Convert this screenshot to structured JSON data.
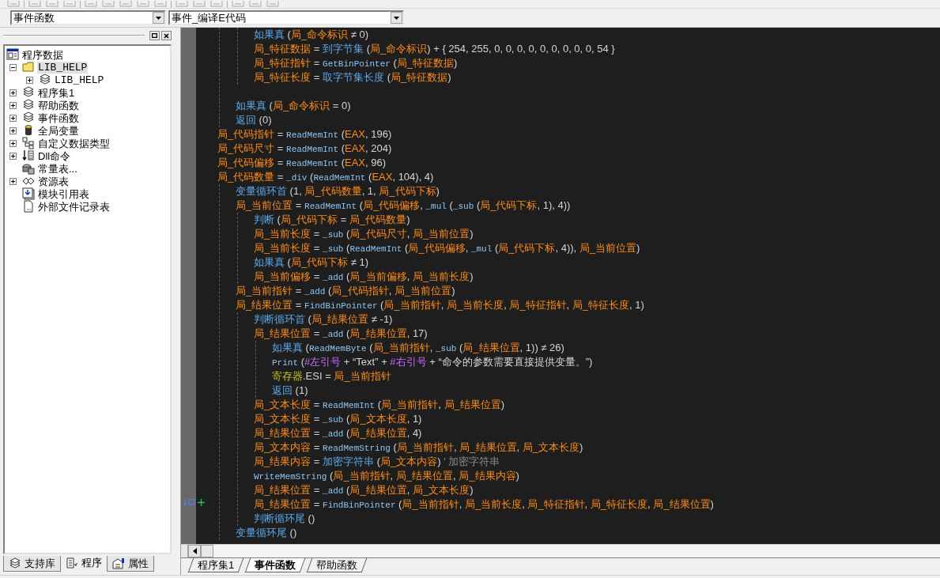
{
  "selectors": [
    {
      "value": "事件函数"
    },
    {
      "value": "事件_编译E代码"
    }
  ],
  "project_tree": [
    {
      "label": "程序数据",
      "kind": "root",
      "selected": false,
      "children": [
        {
          "label": "LIB_HELP",
          "kind": "folder",
          "expanded": true,
          "selected": true,
          "children": [
            {
              "label": "LIB_HELP",
              "kind": "module",
              "expanded": false,
              "selected": false
            }
          ]
        },
        {
          "label": "程序集1",
          "kind": "module",
          "expanded": false,
          "selected": false
        },
        {
          "label": "帮助函数",
          "kind": "module",
          "expanded": false,
          "selected": false
        },
        {
          "label": "事件函数",
          "kind": "module",
          "expanded": false,
          "selected": false
        },
        {
          "label": "全局变量",
          "kind": "globals",
          "expanded": false,
          "selected": false
        },
        {
          "label": "自定义数据类型",
          "kind": "types",
          "expanded": false,
          "selected": false
        },
        {
          "label": "Dll命令",
          "kind": "dll",
          "expanded": false,
          "selected": false
        },
        {
          "label": "常量表...",
          "kind": "constants",
          "selected": false
        },
        {
          "label": "资源表",
          "kind": "resources",
          "expanded": false,
          "selected": false
        },
        {
          "label": "模块引用表",
          "kind": "modref",
          "selected": false
        },
        {
          "label": "外部文件记录表",
          "kind": "file",
          "selected": false
        }
      ]
    }
  ],
  "panel_tabs": [
    {
      "label": "支持库",
      "kind": "library",
      "selected": false
    },
    {
      "label": "程序",
      "kind": "program",
      "selected": true
    },
    {
      "label": "属性",
      "kind": "properties",
      "selected": false
    }
  ],
  "code": [
    {
      "kind": "group",
      "children": [
        {
          "kind": "group",
          "children": [
            {
              "kind": "line",
              "segments": [
                {
                  "kind": "kw",
                  "text": "如果真"
                },
                {
                  "kind": "p",
                  "text": " ("
                },
                {
                  "kind": "v",
                  "text": "局_命令标识"
                },
                {
                  "kind": "p",
                  "text": " ≠ 0)"
                }
              ]
            },
            {
              "kind": "line",
              "segments": [
                {
                  "kind": "v",
                  "text": "局_特征数据"
                },
                {
                  "kind": "p",
                  "text": " = "
                },
                {
                  "kind": "kw",
                  "text": "到字节集"
                },
                {
                  "kind": "p",
                  "text": " ("
                },
                {
                  "kind": "v",
                  "text": "局_命令标识"
                },
                {
                  "kind": "p",
                  "text": ") + { 254, 255, 0, 0, 0, 0, 0, 0, 0, 0, 0, 54 }"
                }
              ]
            },
            {
              "kind": "line",
              "segments": [
                {
                  "kind": "v",
                  "text": "局_特征指针"
                },
                {
                  "kind": "p",
                  "text": " = "
                },
                {
                  "kind": "fn",
                  "text": "GetBinPointer"
                },
                {
                  "kind": "p",
                  "text": " ("
                },
                {
                  "kind": "v",
                  "text": "局_特征数据"
                },
                {
                  "kind": "p",
                  "text": ")"
                }
              ]
            },
            {
              "kind": "line",
              "segments": [
                {
                  "kind": "v",
                  "text": "局_特征长度"
                },
                {
                  "kind": "p",
                  "text": " = "
                },
                {
                  "kind": "kw",
                  "text": "取字节集长度"
                },
                {
                  "kind": "p",
                  "text": " ("
                },
                {
                  "kind": "v",
                  "text": "局_特征数据"
                },
                {
                  "kind": "p",
                  "text": ")"
                }
              ]
            }
          ]
        },
        {
          "kind": "blank"
        },
        {
          "kind": "line",
          "segments": [
            {
              "kind": "kw",
              "text": "如果真"
            },
            {
              "kind": "p",
              "text": " ("
            },
            {
              "kind": "v",
              "text": "局_命令标识"
            },
            {
              "kind": "p",
              "text": " = 0)"
            }
          ]
        },
        {
          "kind": "line",
          "segments": [
            {
              "kind": "kw",
              "text": "返回"
            },
            {
              "kind": "p",
              "text": " (0)"
            }
          ]
        }
      ]
    },
    {
      "kind": "line",
      "segments": [
        {
          "kind": "v",
          "text": "局_代码指针"
        },
        {
          "kind": "p",
          "text": " = "
        },
        {
          "kind": "fn",
          "text": "ReadMemInt"
        },
        {
          "kind": "p",
          "text": " ("
        },
        {
          "kind": "v",
          "text": "EAX"
        },
        {
          "kind": "p",
          "text": ", 196)"
        }
      ]
    },
    {
      "kind": "line",
      "segments": [
        {
          "kind": "v",
          "text": "局_代码尺寸"
        },
        {
          "kind": "p",
          "text": " = "
        },
        {
          "kind": "fn",
          "text": "ReadMemInt"
        },
        {
          "kind": "p",
          "text": " ("
        },
        {
          "kind": "v",
          "text": "EAX"
        },
        {
          "kind": "p",
          "text": ", 204)"
        }
      ]
    },
    {
      "kind": "line",
      "segments": [
        {
          "kind": "v",
          "text": "局_代码偏移"
        },
        {
          "kind": "p",
          "text": " = "
        },
        {
          "kind": "fn",
          "text": "ReadMemInt"
        },
        {
          "kind": "p",
          "text": " ("
        },
        {
          "kind": "v",
          "text": "EAX"
        },
        {
          "kind": "p",
          "text": ", 96)"
        }
      ]
    },
    {
      "kind": "line",
      "segments": [
        {
          "kind": "v",
          "text": "局_代码数量"
        },
        {
          "kind": "p",
          "text": " = "
        },
        {
          "kind": "fn",
          "text": "_div"
        },
        {
          "kind": "p",
          "text": " ("
        },
        {
          "kind": "fn",
          "text": "ReadMemInt"
        },
        {
          "kind": "p",
          "text": " ("
        },
        {
          "kind": "v",
          "text": "EAX"
        },
        {
          "kind": "p",
          "text": ", 104), 4)"
        }
      ],
      "children": [
        {
          "kind": "line",
          "segments": [
            {
              "kind": "kw",
              "text": "变量循环首"
            },
            {
              "kind": "p",
              "text": " (1, "
            },
            {
              "kind": "v",
              "text": "局_代码数量"
            },
            {
              "kind": "p",
              "text": ", 1, "
            },
            {
              "kind": "v",
              "text": "局_代码下标"
            },
            {
              "kind": "p",
              "text": ")"
            }
          ]
        },
        {
          "kind": "line",
          "segments": [
            {
              "kind": "v",
              "text": "局_当前位置"
            },
            {
              "kind": "p",
              "text": " = "
            },
            {
              "kind": "fn",
              "text": "ReadMemInt"
            },
            {
              "kind": "p",
              "text": " ("
            },
            {
              "kind": "v",
              "text": "局_代码偏移"
            },
            {
              "kind": "p",
              "text": ", "
            },
            {
              "kind": "fn",
              "text": "_mul"
            },
            {
              "kind": "p",
              "text": " ("
            },
            {
              "kind": "fn",
              "text": "_sub"
            },
            {
              "kind": "p",
              "text": " ("
            },
            {
              "kind": "v",
              "text": "局_代码下标"
            },
            {
              "kind": "p",
              "text": ", 1), 4))"
            }
          ],
          "children": [
            {
              "kind": "line",
              "segments": [
                {
                  "kind": "kw",
                  "text": "判断"
                },
                {
                  "kind": "p",
                  "text": " ("
                },
                {
                  "kind": "v",
                  "text": "局_代码下标"
                },
                {
                  "kind": "p",
                  "text": " = "
                },
                {
                  "kind": "v",
                  "text": "局_代码数量"
                },
                {
                  "kind": "p",
                  "text": ")"
                }
              ]
            },
            {
              "kind": "line",
              "segments": [
                {
                  "kind": "v",
                  "text": "局_当前长度"
                },
                {
                  "kind": "p",
                  "text": " = "
                },
                {
                  "kind": "fn",
                  "text": "_sub"
                },
                {
                  "kind": "p",
                  "text": " ("
                },
                {
                  "kind": "v",
                  "text": "局_代码尺寸"
                },
                {
                  "kind": "p",
                  "text": ", "
                },
                {
                  "kind": "v",
                  "text": "局_当前位置"
                },
                {
                  "kind": "p",
                  "text": ")"
                }
              ]
            },
            {
              "kind": "line",
              "segments": [
                {
                  "kind": "v",
                  "text": "局_当前长度"
                },
                {
                  "kind": "p",
                  "text": " = "
                },
                {
                  "kind": "fn",
                  "text": "_sub"
                },
                {
                  "kind": "p",
                  "text": " ("
                },
                {
                  "kind": "fn",
                  "text": "ReadMemInt"
                },
                {
                  "kind": "p",
                  "text": " ("
                },
                {
                  "kind": "v",
                  "text": "局_代码偏移"
                },
                {
                  "kind": "p",
                  "text": ", "
                },
                {
                  "kind": "fn",
                  "text": "_mul"
                },
                {
                  "kind": "p",
                  "text": " ("
                },
                {
                  "kind": "v",
                  "text": "局_代码下标"
                },
                {
                  "kind": "p",
                  "text": ", 4)), "
                },
                {
                  "kind": "v",
                  "text": "局_当前位置"
                },
                {
                  "kind": "p",
                  "text": ")"
                }
              ]
            },
            {
              "kind": "line",
              "segments": [
                {
                  "kind": "kw",
                  "text": "如果真"
                },
                {
                  "kind": "p",
                  "text": " ("
                },
                {
                  "kind": "v",
                  "text": "局_代码下标"
                },
                {
                  "kind": "p",
                  "text": " ≠ 1)"
                }
              ]
            },
            {
              "kind": "line",
              "segments": [
                {
                  "kind": "v",
                  "text": "局_当前偏移"
                },
                {
                  "kind": "p",
                  "text": " = "
                },
                {
                  "kind": "fn",
                  "text": "_add"
                },
                {
                  "kind": "p",
                  "text": " ("
                },
                {
                  "kind": "v",
                  "text": "局_当前偏移"
                },
                {
                  "kind": "p",
                  "text": ", "
                },
                {
                  "kind": "v",
                  "text": "局_当前长度"
                },
                {
                  "kind": "p",
                  "text": ")"
                }
              ]
            }
          ]
        },
        {
          "kind": "line",
          "segments": [
            {
              "kind": "v",
              "text": "局_当前指针"
            },
            {
              "kind": "p",
              "text": " = "
            },
            {
              "kind": "fn",
              "text": "_add"
            },
            {
              "kind": "p",
              "text": " ("
            },
            {
              "kind": "v",
              "text": "局_代码指针"
            },
            {
              "kind": "p",
              "text": ", "
            },
            {
              "kind": "v",
              "text": "局_当前位置"
            },
            {
              "kind": "p",
              "text": ")"
            }
          ]
        },
        {
          "kind": "line",
          "segments": [
            {
              "kind": "v",
              "text": "局_结果位置"
            },
            {
              "kind": "p",
              "text": " = "
            },
            {
              "kind": "fn",
              "text": "FindBinPointer"
            },
            {
              "kind": "p",
              "text": " ("
            },
            {
              "kind": "v",
              "text": "局_当前指针"
            },
            {
              "kind": "p",
              "text": ", "
            },
            {
              "kind": "v",
              "text": "局_当前长度"
            },
            {
              "kind": "p",
              "text": ", "
            },
            {
              "kind": "v",
              "text": "局_特征指针"
            },
            {
              "kind": "p",
              "text": ", "
            },
            {
              "kind": "v",
              "text": "局_特征长度"
            },
            {
              "kind": "p",
              "text": ", 1)"
            }
          ],
          "children": [
            {
              "kind": "line",
              "segments": [
                {
                  "kind": "kw",
                  "text": "判断循环首"
                },
                {
                  "kind": "p",
                  "text": " ("
                },
                {
                  "kind": "v",
                  "text": "局_结果位置"
                },
                {
                  "kind": "p",
                  "text": " ≠ -1)"
                }
              ]
            },
            {
              "kind": "line",
              "segments": [
                {
                  "kind": "v",
                  "text": "局_结果位置"
                },
                {
                  "kind": "p",
                  "text": " = "
                },
                {
                  "kind": "fn",
                  "text": "_add"
                },
                {
                  "kind": "p",
                  "text": " ("
                },
                {
                  "kind": "v",
                  "text": "局_结果位置"
                },
                {
                  "kind": "p",
                  "text": ", 17)"
                }
              ],
              "children": [
                {
                  "kind": "line",
                  "segments": [
                    {
                      "kind": "kw",
                      "text": "如果真"
                    },
                    {
                      "kind": "p",
                      "text": " ("
                    },
                    {
                      "kind": "fn",
                      "text": "ReadMemByte"
                    },
                    {
                      "kind": "p",
                      "text": " ("
                    },
                    {
                      "kind": "v",
                      "text": "局_当前指针"
                    },
                    {
                      "kind": "p",
                      "text": ", "
                    },
                    {
                      "kind": "fn",
                      "text": "_sub"
                    },
                    {
                      "kind": "p",
                      "text": " ("
                    },
                    {
                      "kind": "v",
                      "text": "局_结果位置"
                    },
                    {
                      "kind": "p",
                      "text": ", 1)) ≠ 26)"
                    }
                  ]
                },
                {
                  "kind": "line",
                  "segments": [
                    {
                      "kind": "fn",
                      "text": "Print"
                    },
                    {
                      "kind": "p",
                      "text": " ("
                    },
                    {
                      "kind": "c",
                      "text": "#左引号"
                    },
                    {
                      "kind": "p",
                      "text": " + “Text” + "
                    },
                    {
                      "kind": "c",
                      "text": "#右引号"
                    },
                    {
                      "kind": "p",
                      "text": " + “命令的参数需要直接提供变量。”)"
                    }
                  ]
                },
                {
                  "kind": "line",
                  "segments": [
                    {
                      "kind": "r",
                      "text": "寄存器"
                    },
                    {
                      "kind": "p",
                      "text": ".ESI = "
                    },
                    {
                      "kind": "v",
                      "text": "局_当前指针"
                    }
                  ]
                },
                {
                  "kind": "line",
                  "segments": [
                    {
                      "kind": "kw",
                      "text": "返回"
                    },
                    {
                      "kind": "p",
                      "text": " (1)"
                    }
                  ]
                }
              ]
            },
            {
              "kind": "line",
              "segments": [
                {
                  "kind": "v",
                  "text": "局_文本长度"
                },
                {
                  "kind": "p",
                  "text": " = "
                },
                {
                  "kind": "fn",
                  "text": "ReadMemInt"
                },
                {
                  "kind": "p",
                  "text": " ("
                },
                {
                  "kind": "v",
                  "text": "局_当前指针"
                },
                {
                  "kind": "p",
                  "text": ", "
                },
                {
                  "kind": "v",
                  "text": "局_结果位置"
                },
                {
                  "kind": "p",
                  "text": ")"
                }
              ]
            },
            {
              "kind": "line",
              "segments": [
                {
                  "kind": "v",
                  "text": "局_文本长度"
                },
                {
                  "kind": "p",
                  "text": " = "
                },
                {
                  "kind": "fn",
                  "text": "_sub"
                },
                {
                  "kind": "p",
                  "text": " ("
                },
                {
                  "kind": "v",
                  "text": "局_文本长度"
                },
                {
                  "kind": "p",
                  "text": ", 1)"
                }
              ]
            },
            {
              "kind": "line",
              "segments": [
                {
                  "kind": "v",
                  "text": "局_结果位置"
                },
                {
                  "kind": "p",
                  "text": " = "
                },
                {
                  "kind": "fn",
                  "text": "_add"
                },
                {
                  "kind": "p",
                  "text": " ("
                },
                {
                  "kind": "v",
                  "text": "局_结果位置"
                },
                {
                  "kind": "p",
                  "text": ", 4)"
                }
              ]
            },
            {
              "kind": "line",
              "segments": [
                {
                  "kind": "v",
                  "text": "局_文本内容"
                },
                {
                  "kind": "p",
                  "text": " = "
                },
                {
                  "kind": "fn",
                  "text": "ReadMemString"
                },
                {
                  "kind": "p",
                  "text": " ("
                },
                {
                  "kind": "v",
                  "text": "局_当前指针"
                },
                {
                  "kind": "p",
                  "text": ", "
                },
                {
                  "kind": "v",
                  "text": "局_结果位置"
                },
                {
                  "kind": "p",
                  "text": ", "
                },
                {
                  "kind": "v",
                  "text": "局_文本长度"
                },
                {
                  "kind": "p",
                  "text": ")"
                }
              ]
            },
            {
              "kind": "line",
              "segments": [
                {
                  "kind": "v",
                  "text": "局_结果内容"
                },
                {
                  "kind": "p",
                  "text": " = "
                },
                {
                  "kind": "kw",
                  "text": "加密字符串"
                },
                {
                  "kind": "p",
                  "text": " ("
                },
                {
                  "kind": "v",
                  "text": "局_文本内容"
                },
                {
                  "kind": "p",
                  "text": ")"
                },
                {
                  "kind": "cm",
                  "text": " ′ 加密字符串"
                }
              ]
            },
            {
              "kind": "line",
              "segments": [
                {
                  "kind": "fn",
                  "text": "WriteMemString"
                },
                {
                  "kind": "p",
                  "text": " ("
                },
                {
                  "kind": "v",
                  "text": "局_当前指针"
                },
                {
                  "kind": "p",
                  "text": ", "
                },
                {
                  "kind": "v",
                  "text": "局_结果位置"
                },
                {
                  "kind": "p",
                  "text": ", "
                },
                {
                  "kind": "v",
                  "text": "局_结果内容"
                },
                {
                  "kind": "p",
                  "text": ")"
                }
              ]
            },
            {
              "kind": "line",
              "segments": [
                {
                  "kind": "v",
                  "text": "局_结果位置"
                },
                {
                  "kind": "p",
                  "text": " = "
                },
                {
                  "kind": "fn",
                  "text": "_add"
                },
                {
                  "kind": "p",
                  "text": " ("
                },
                {
                  "kind": "v",
                  "text": "局_结果位置"
                },
                {
                  "kind": "p",
                  "text": ", "
                },
                {
                  "kind": "v",
                  "text": "局_文本长度"
                },
                {
                  "kind": "p",
                  "text": ")"
                }
              ]
            },
            {
              "kind": "line",
              "segments": [
                {
                  "kind": "v",
                  "text": "局_结果位置"
                },
                {
                  "kind": "p",
                  "text": " = "
                },
                {
                  "kind": "fn",
                  "text": "FindBinPointer"
                },
                {
                  "kind": "p",
                  "text": " ("
                },
                {
                  "kind": "v",
                  "text": "局_当前指针"
                },
                {
                  "kind": "p",
                  "text": ", "
                },
                {
                  "kind": "v",
                  "text": "局_当前长度"
                },
                {
                  "kind": "p",
                  "text": ", "
                },
                {
                  "kind": "v",
                  "text": "局_特征指针"
                },
                {
                  "kind": "p",
                  "text": ", "
                },
                {
                  "kind": "v",
                  "text": "局_特征长度"
                },
                {
                  "kind": "p",
                  "text": ", "
                },
                {
                  "kind": "v",
                  "text": "局_结果位置"
                },
                {
                  "kind": "p",
                  "text": ")"
                }
              ]
            },
            {
              "kind": "line",
              "segments": [
                {
                  "kind": "kw",
                  "text": "判断循环尾"
                },
                {
                  "kind": "p",
                  "text": " ()"
                }
              ]
            }
          ]
        },
        {
          "kind": "line",
          "segments": [
            {
              "kind": "kw",
              "text": "变量循环尾"
            },
            {
              "kind": "p",
              "text": " ()"
            }
          ]
        }
      ]
    }
  ],
  "file_tabs": [
    {
      "label": "程序集1",
      "selected": false
    },
    {
      "label": "事件函数",
      "selected": true
    },
    {
      "label": "帮助函数",
      "selected": false
    }
  ]
}
